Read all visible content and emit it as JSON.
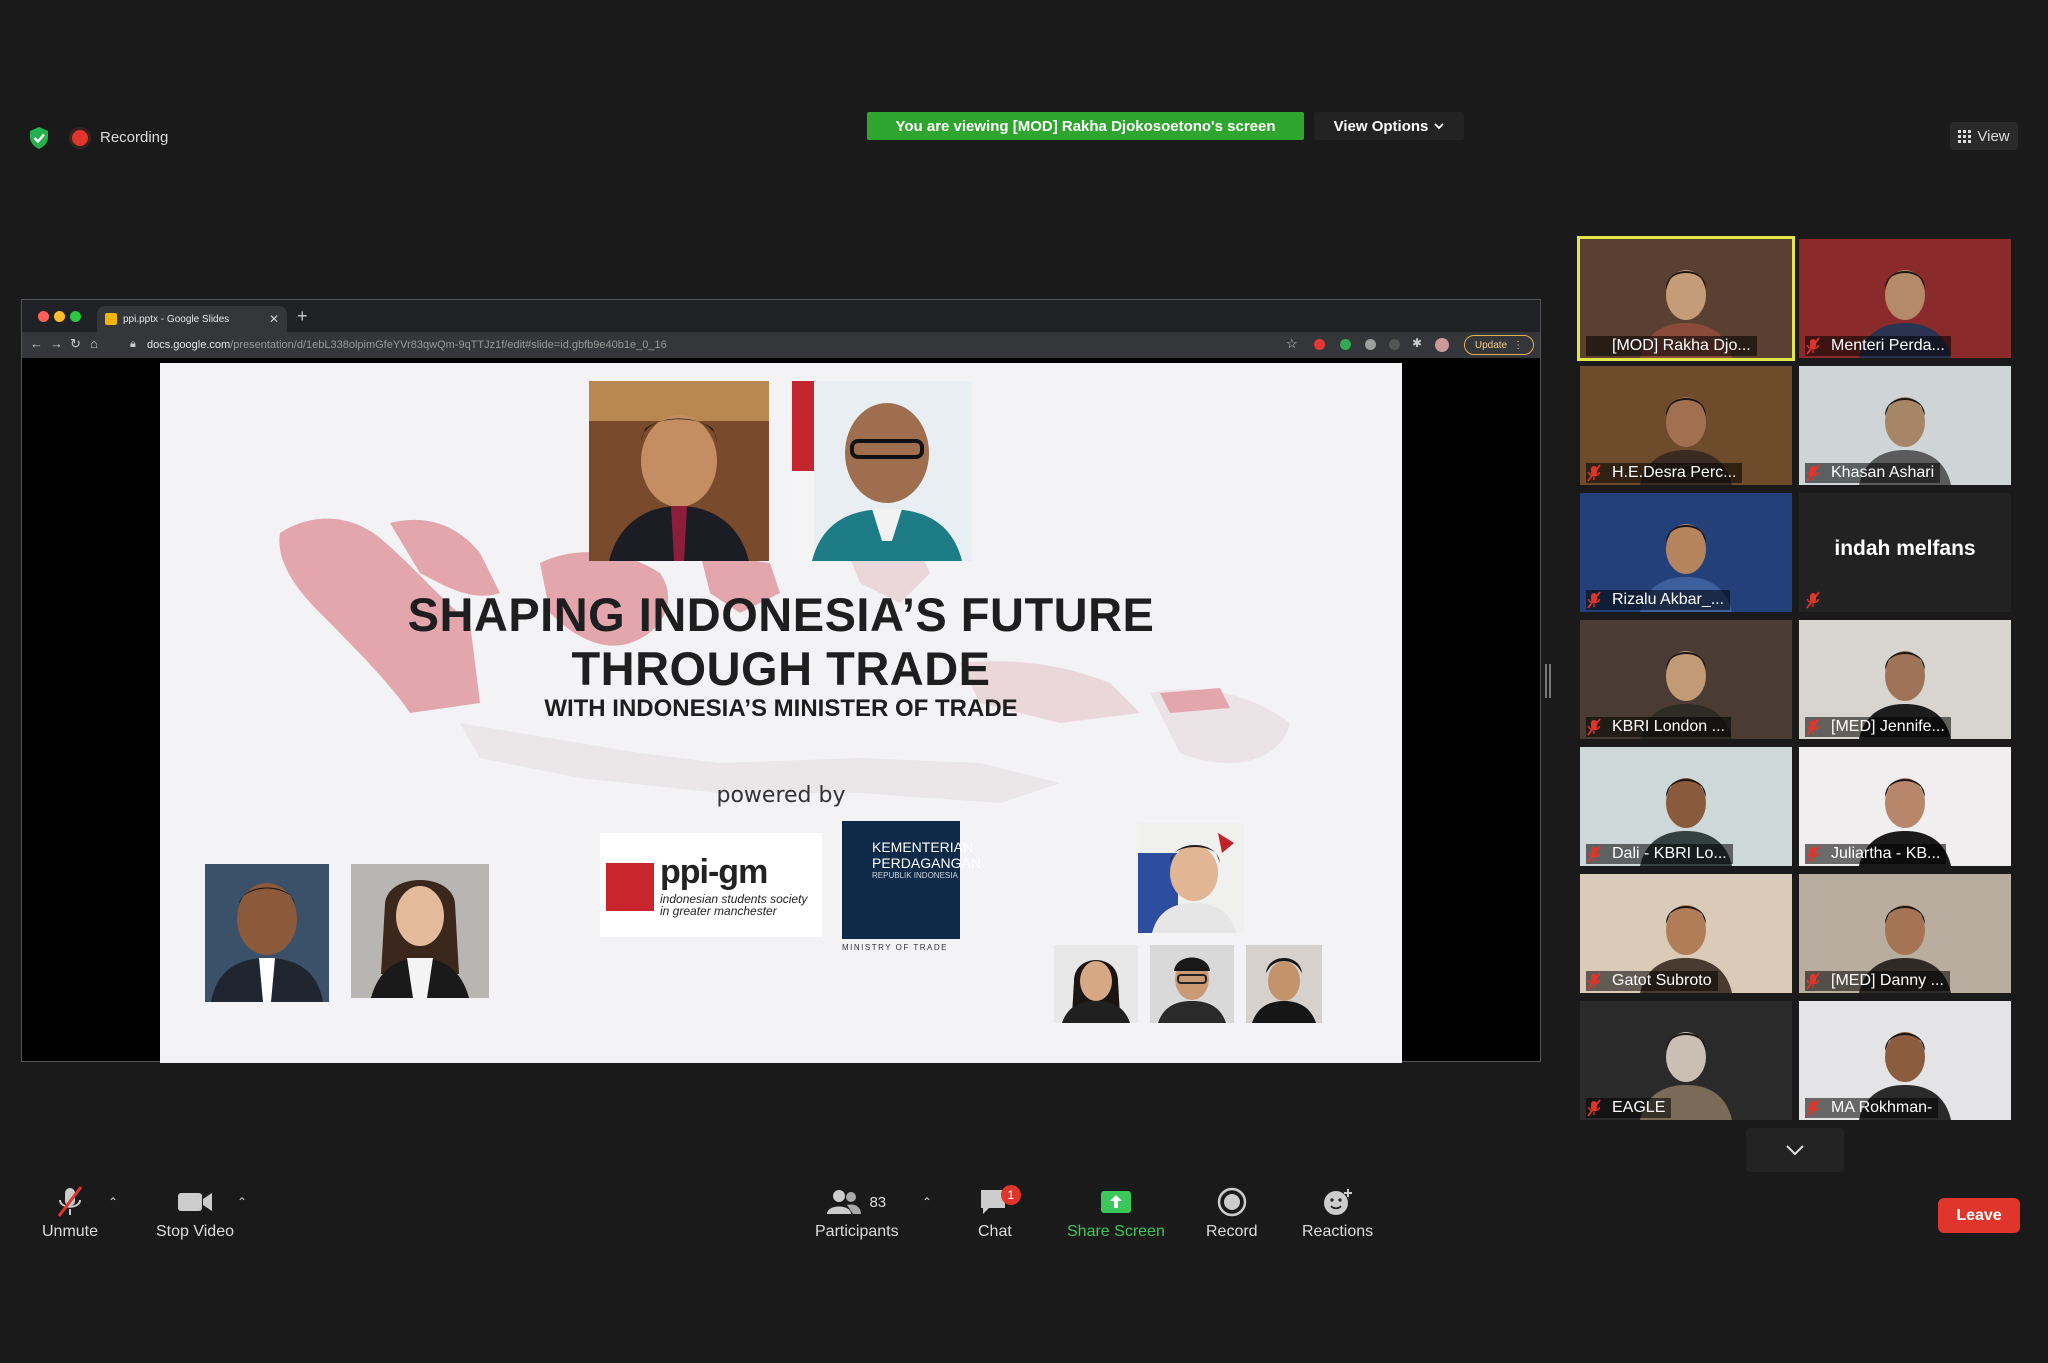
{
  "top_bar": {
    "recording_label": "Recording",
    "viewing_banner": "You are viewing [MOD] Rakha Djokosoetono's screen",
    "view_options_label": "View Options",
    "view_label": "View"
  },
  "browser": {
    "tab_title": "ppi.pptx - Google Slides",
    "url_domain": "docs.google.com",
    "url_path": "/presentation/d/1ebL338olpimGfeYVr83qwQm-9qTTJz1f/edit#slide=id.gbfb9e40b1e_0_16",
    "update_label": "Update"
  },
  "slide": {
    "title_line1": "SHAPING INDONESIA’S FUTURE",
    "title_line2": "THROUGH TRADE",
    "subtitle": "WITH INDONESIA’S MINISTER OF TRADE",
    "powered_by": "powered by",
    "ppigm_name": "ppi-gm",
    "ppigm_tagline": "indonesian students society in greater manchester",
    "kemendag_line1": "KEMENTERIAN",
    "kemendag_line2": "PERDAGANGAN",
    "kemendag_line3": "REPUBLIK INDONESIA",
    "kemendag_caption": "MINISTRY OF TRADE"
  },
  "participants": [
    {
      "name": "[MOD] Rakha Djo...",
      "active": true,
      "muted": false
    },
    {
      "name": "Menteri Perda...",
      "muted": true
    },
    {
      "name": "H.E.Desra Perc...",
      "muted": true
    },
    {
      "name": "Khasan Ashari",
      "muted": true
    },
    {
      "name": "Rizalu Akbar_...",
      "muted": true
    },
    {
      "name": "indah melfans",
      "muted": true,
      "video_off": true
    },
    {
      "name": "KBRI London ...",
      "muted": true
    },
    {
      "name": "[MED] Jennife...",
      "muted": true
    },
    {
      "name": "Dali - KBRI Lo...",
      "muted": true
    },
    {
      "name": "Juliartha - KB...",
      "muted": true
    },
    {
      "name": "Gatot Subroto",
      "muted": true
    },
    {
      "name": "[MED] Danny ...",
      "muted": true
    },
    {
      "name": "EAGLE",
      "muted": true
    },
    {
      "name": "MA Rokhman-",
      "muted": true
    }
  ],
  "controls": {
    "unmute_label": "Unmute",
    "stop_video_label": "Stop Video",
    "participants_label": "Participants",
    "participants_count": "83",
    "chat_label": "Chat",
    "chat_badge": "1",
    "share_screen_label": "Share Screen",
    "record_label": "Record",
    "reactions_label": "Reactions",
    "leave_label": "Leave"
  },
  "colors": {
    "banner_green": "#2ea52e",
    "leave_red": "#e0352b",
    "share_green": "#3cc75a",
    "active_speaker": "#e3e64a"
  }
}
